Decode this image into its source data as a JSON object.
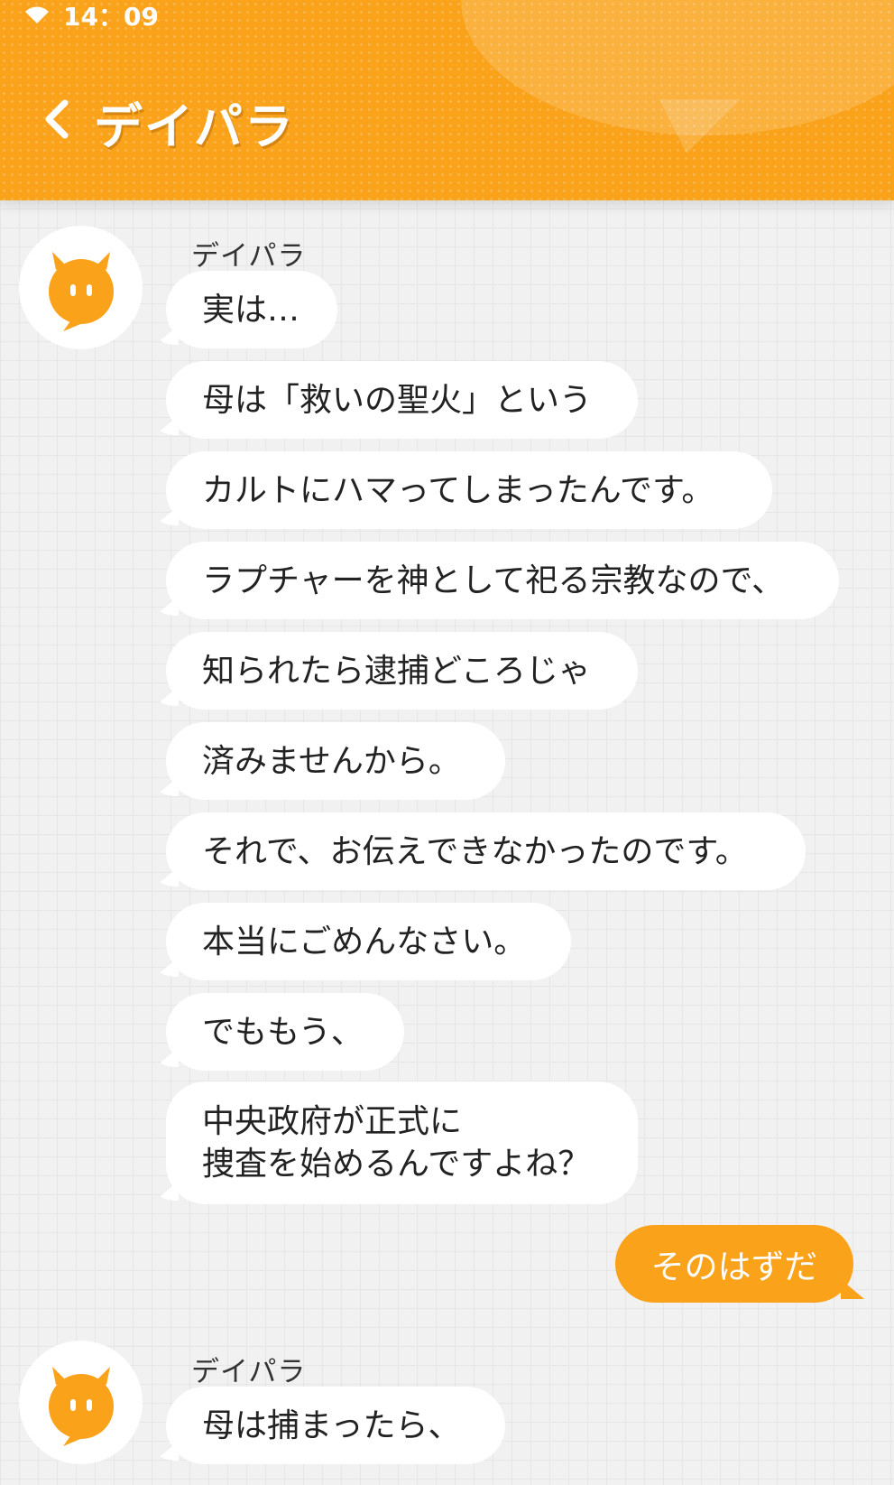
{
  "status_bar": {
    "time": "14：09",
    "wifi_icon": "wifi-icon"
  },
  "header": {
    "title": "デイパラ",
    "back_icon": "chevron-left-icon",
    "color": "#f9a21a"
  },
  "chat": {
    "groups": [
      {
        "sender": "デイパラ",
        "avatar_icon": "chat-bubble-face-icon",
        "messages": [
          "実は…",
          "母は「救いの聖火」という",
          "カルトにハマってしまったんです。",
          "ラプチャーを神として祀る宗教なので、",
          "知られたら逮捕どころじゃ",
          "済みませんから。",
          "それで、お伝えできなかったのです。",
          "本当にごめんなさい。",
          "でももう、",
          "中央政府が正式に\n捜査を始めるんですよね？"
        ]
      },
      {
        "sender": "デイパラ",
        "avatar_icon": "chat-bubble-face-icon",
        "messages": [
          "母は捕まったら、"
        ]
      }
    ],
    "outgoing": [
      "そのはずだ"
    ]
  }
}
